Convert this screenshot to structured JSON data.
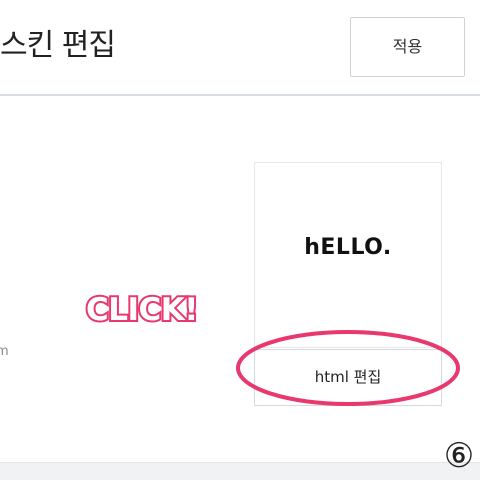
{
  "header": {
    "title": "스킨 편집",
    "apply_label": "적용"
  },
  "main": {
    "left_clipped_text": "m",
    "preview": {
      "text": "hELLO."
    },
    "html_edit_label": "html 편집"
  },
  "annotation": {
    "click_text": "CLICK!",
    "step_number": "⑥",
    "highlight_color": "#e8386e"
  },
  "colors": {
    "border": "#d9dde4",
    "bottom_band": "#f1f2f4"
  }
}
